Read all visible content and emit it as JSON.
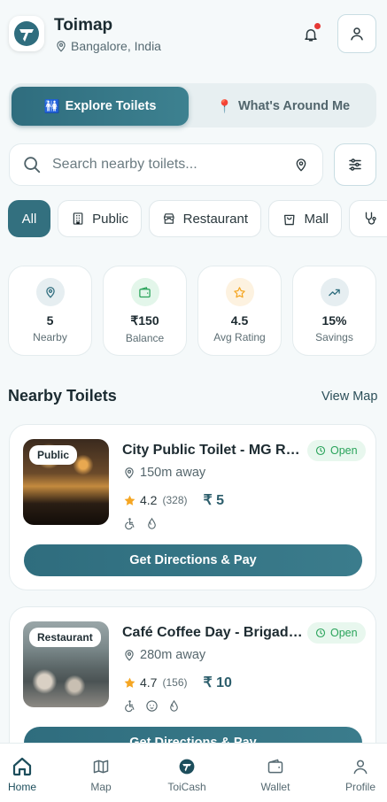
{
  "header": {
    "app_name": "Toimap",
    "location": "Bangalore, India"
  },
  "segment": {
    "explore_label": "Explore Toilets",
    "explore_emoji": "🚻",
    "around_label": "What's Around Me",
    "around_emoji": "📍"
  },
  "search": {
    "placeholder": "Search nearby toilets..."
  },
  "chips": [
    {
      "label": "All",
      "icon": "none"
    },
    {
      "label": "Public",
      "icon": "building-icon"
    },
    {
      "label": "Restaurant",
      "icon": "store-icon"
    },
    {
      "label": "Mall",
      "icon": "shopping-bag-icon"
    },
    {
      "label": "",
      "icon": "stethoscope-icon"
    }
  ],
  "stats": [
    {
      "value": "5",
      "label": "Nearby",
      "icon": "pin-icon",
      "color": "#e6eef1"
    },
    {
      "value": "₹150",
      "label": "Balance",
      "icon": "wallet-icon",
      "color": "#e3f6ea"
    },
    {
      "value": "4.5",
      "label": "Avg Rating",
      "icon": "star-icon",
      "color": "#fdf2e0"
    },
    {
      "value": "15%",
      "label": "Savings",
      "icon": "trend-up-icon",
      "color": "#e6eef1"
    }
  ],
  "section": {
    "title": "Nearby Toilets",
    "view_map": "View Map"
  },
  "toilets": [
    {
      "tag": "Public",
      "name": "City Public Toilet - MG Road",
      "status": "Open",
      "distance": "150m away",
      "rating": "4.2",
      "reviews": "(328)",
      "currency": "₹",
      "price": "5",
      "amenities": [
        "wheelchair-icon",
        "water-drop-icon"
      ],
      "button": "Get Directions & Pay"
    },
    {
      "tag": "Restaurant",
      "name": "Café Coffee Day - Brigade Road",
      "status": "Open",
      "distance": "280m away",
      "rating": "4.7",
      "reviews": "(156)",
      "currency": "₹",
      "price": "10",
      "amenities": [
        "wheelchair-icon",
        "baby-icon",
        "water-drop-icon"
      ],
      "button": "Get Directions & Pay"
    }
  ],
  "nav": {
    "home": "Home",
    "map": "Map",
    "toicash": "ToiCash",
    "wallet": "Wallet",
    "profile": "Profile"
  },
  "colors": {
    "primary": "#33707f",
    "open_green": "#29a35a",
    "star": "#f5a623",
    "notification_dot": "#e53935"
  }
}
